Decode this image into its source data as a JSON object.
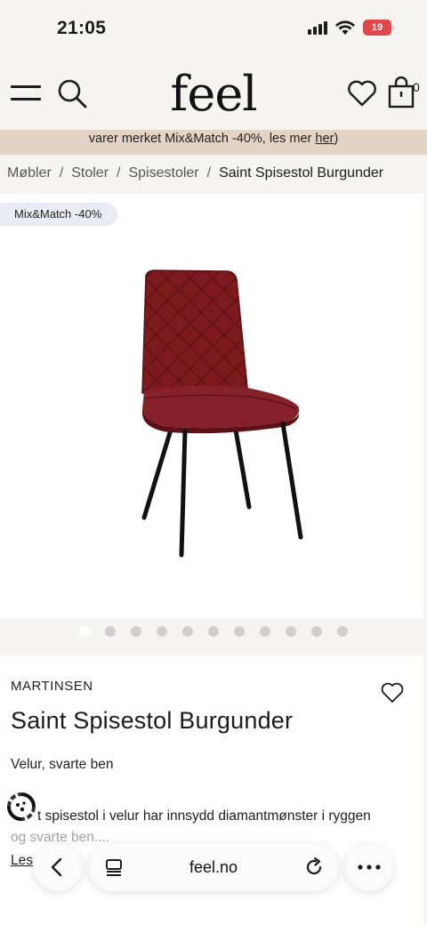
{
  "status_bar": {
    "time": "21:05",
    "battery": "19"
  },
  "header": {
    "logo": "feel",
    "cart_count": "0"
  },
  "banner": {
    "text": "varer merket Mix&Match -40%, les mer ",
    "link": "her",
    "suffix": ")"
  },
  "breadcrumb": [
    {
      "label": "Møbler"
    },
    {
      "label": "Stoler"
    },
    {
      "label": "Spisestoler"
    },
    {
      "label": "Saint Spisestol Burgunder"
    }
  ],
  "gallery": {
    "badge": "Mix&Match -40%",
    "image_count": 11,
    "active_index": 0,
    "chair_color": "#7d1a1e"
  },
  "product": {
    "brand": "MARTINSEN",
    "title": "Saint Spisestol Burgunder",
    "subtitle": "Velur, svarte ben",
    "description_line1": "t spisestol i velur har innsydd diamantmønster i ryggen",
    "description_line2": "og svarte ben....",
    "read_more": "Les"
  },
  "browser": {
    "url": "feel.no"
  },
  "colors": {
    "background": "#f6f4f0",
    "banner": "#e4d4c6",
    "badge": "#e9ecf3",
    "battery": "#e0474c"
  }
}
